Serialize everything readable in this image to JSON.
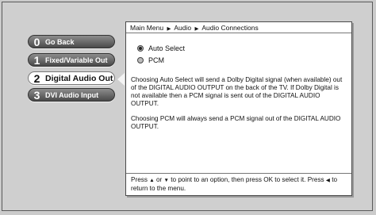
{
  "menu": {
    "items": [
      {
        "number": "0",
        "label": "Go Back"
      },
      {
        "number": "1",
        "label": "Fixed/Variable Out"
      },
      {
        "number": "2",
        "label": "Digital Audio Out"
      },
      {
        "number": "3",
        "label": "DVI Audio Input"
      }
    ],
    "selected_index": 2
  },
  "panel": {
    "breadcrumb": {
      "items": [
        "Main Menu",
        "Audio",
        "Audio Connections"
      ],
      "separator": "▶"
    },
    "options": [
      {
        "label": "Auto Select",
        "selected": true
      },
      {
        "label": "PCM",
        "selected": false
      }
    ],
    "description1": "Choosing Auto Select will send a Dolby Digital signal (when available) out of the DIGITAL AUDIO OUTPUT on the back of the TV. If Dolby Digital is not available then a PCM signal is sent out of the DIGITAL AUDIO OUTPUT.",
    "description2": "Choosing PCM will always send a PCM signal out of the DIGITAL AUDIO OUTPUT.",
    "footer": {
      "part1": "Press",
      "up_glyph": "▲",
      "part2": "or",
      "down_glyph": "▼",
      "part3": "to point to an option, then press OK to select it. Press",
      "left_glyph": "◀",
      "part4": "to return to the menu."
    }
  },
  "colors": {
    "background": "#cbcbcb",
    "button_dark": "#5a5a5a",
    "button_selected": "#ffffff",
    "panel": "#ffffff"
  },
  "icons": {
    "breadcrumb_separator": "triangle-right-icon",
    "selected_pointer": "triangle-left-icon",
    "radio_on": "radio-on-icon",
    "radio_off": "radio-off-icon"
  }
}
